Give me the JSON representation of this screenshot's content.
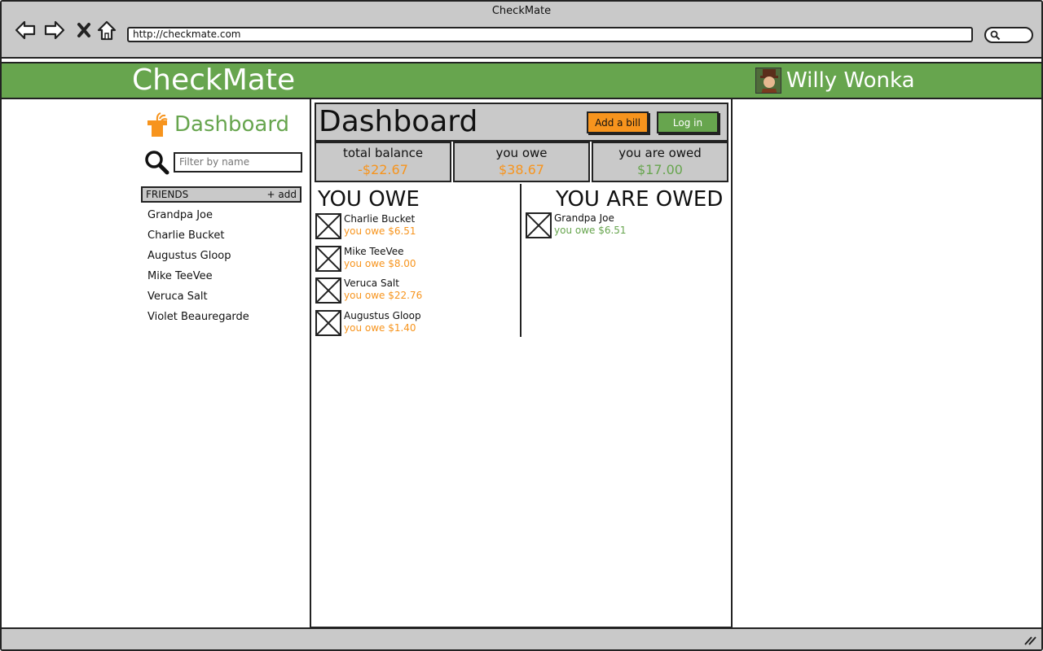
{
  "window": {
    "title": "CheckMate",
    "url": "http://checkmate.com"
  },
  "app": {
    "brand": "CheckMate",
    "user_name": "Willy Wonka"
  },
  "sidebar": {
    "title": "Dashboard",
    "filter_placeholder": "Filter by name",
    "friends_label": "FRIENDS",
    "add_label": "+ add",
    "friends": [
      "Grandpa Joe",
      "Charlie Bucket",
      "Augustus Gloop",
      "Mike TeeVee",
      "Veruca Salt",
      "Violet Beauregarde"
    ]
  },
  "dashboard": {
    "title": "Dashboard",
    "add_bill_label": "Add a bill",
    "login_label": "Log in",
    "stats": {
      "total_balance_label": "total balance",
      "total_balance_value": "-$22.67",
      "you_owe_label": "you owe",
      "you_owe_value": "$38.67",
      "you_are_owed_label": "you are owed",
      "you_are_owed_value": "$17.00"
    },
    "you_owe_title": "YOU OWE",
    "you_are_owed_title": "YOU ARE OWED",
    "you_owe_items": [
      {
        "name": "Charlie Bucket",
        "amount": "you owe $6.51"
      },
      {
        "name": "Mike TeeVee",
        "amount": "you owe $8.00"
      },
      {
        "name": "Veruca Salt",
        "amount": "you owe $22.76"
      },
      {
        "name": "Augustus Gloop",
        "amount": "you owe $1.40"
      }
    ],
    "you_are_owed_items": [
      {
        "name": "Grandpa Joe",
        "amount": "you owe $6.51"
      }
    ]
  },
  "colors": {
    "brand_green": "#67a54e",
    "accent_orange": "#f7941d",
    "chrome_gray": "#c9c9c9"
  }
}
